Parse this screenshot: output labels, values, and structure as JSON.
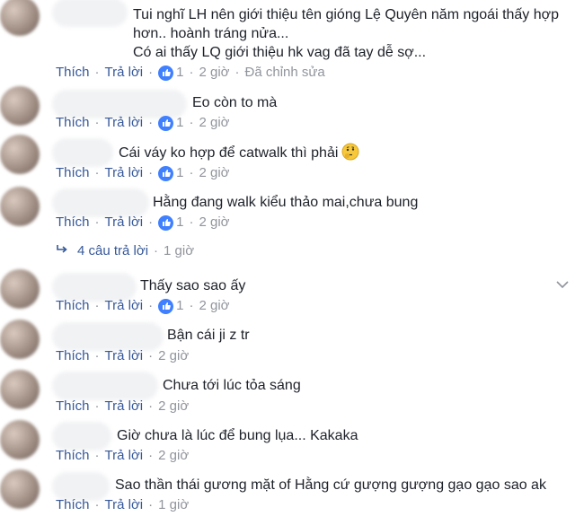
{
  "comments": [
    {
      "text": "Tui nghĩ LH nên giới thiệu tên gióng Lệ Quyên năm ngoái thấy hợp\nhơn.. hoành tráng nửa...\nCó ai thấy LQ giới thiệu hk vag đã tay dễ sợ...",
      "likes": "1",
      "time": "2 giờ",
      "edited": "Đã chỉnh sửa"
    },
    {
      "text": "Eo còn to mà",
      "likes": "1",
      "time": "2 giờ"
    },
    {
      "text": "Cái váy ko hợp để catwalk thì phải",
      "likes": "1",
      "time": "2 giờ"
    },
    {
      "text": "Hằng đang walk kiểu thảo mai,chưa bung",
      "likes": "1",
      "time": "2 giờ"
    },
    {
      "text": "Thấy sao sao ấy",
      "likes": "1",
      "time": "2 giờ"
    },
    {
      "text": "Bận cái ji z tr",
      "time": "2 giờ"
    },
    {
      "text": "Chưa tới lúc tỏa sáng",
      "time": "2 giờ"
    },
    {
      "text": "Giờ chưa là lúc để bung lụa... Kakaka",
      "time": "2 giờ"
    },
    {
      "text": "Sao thần thái gương mặt of Hằng cứ gượng gượng gạo gạo sao ak",
      "time": "1 giờ"
    }
  ],
  "labels": {
    "like": "Thích",
    "reply": "Trả lời",
    "dot": "·"
  },
  "replies_row": {
    "count": "4 câu trả lời",
    "time": "1 giờ"
  },
  "icons": {
    "like_badge": "thumbs-up-icon",
    "reply": "reply-arrow-icon",
    "menu": "chevron-down-icon",
    "emoji": "thinking-face-icon"
  },
  "colors": {
    "link": "#365899",
    "meta": "#90949c",
    "like_badge": "#4080ff",
    "text": "#1d2129"
  }
}
